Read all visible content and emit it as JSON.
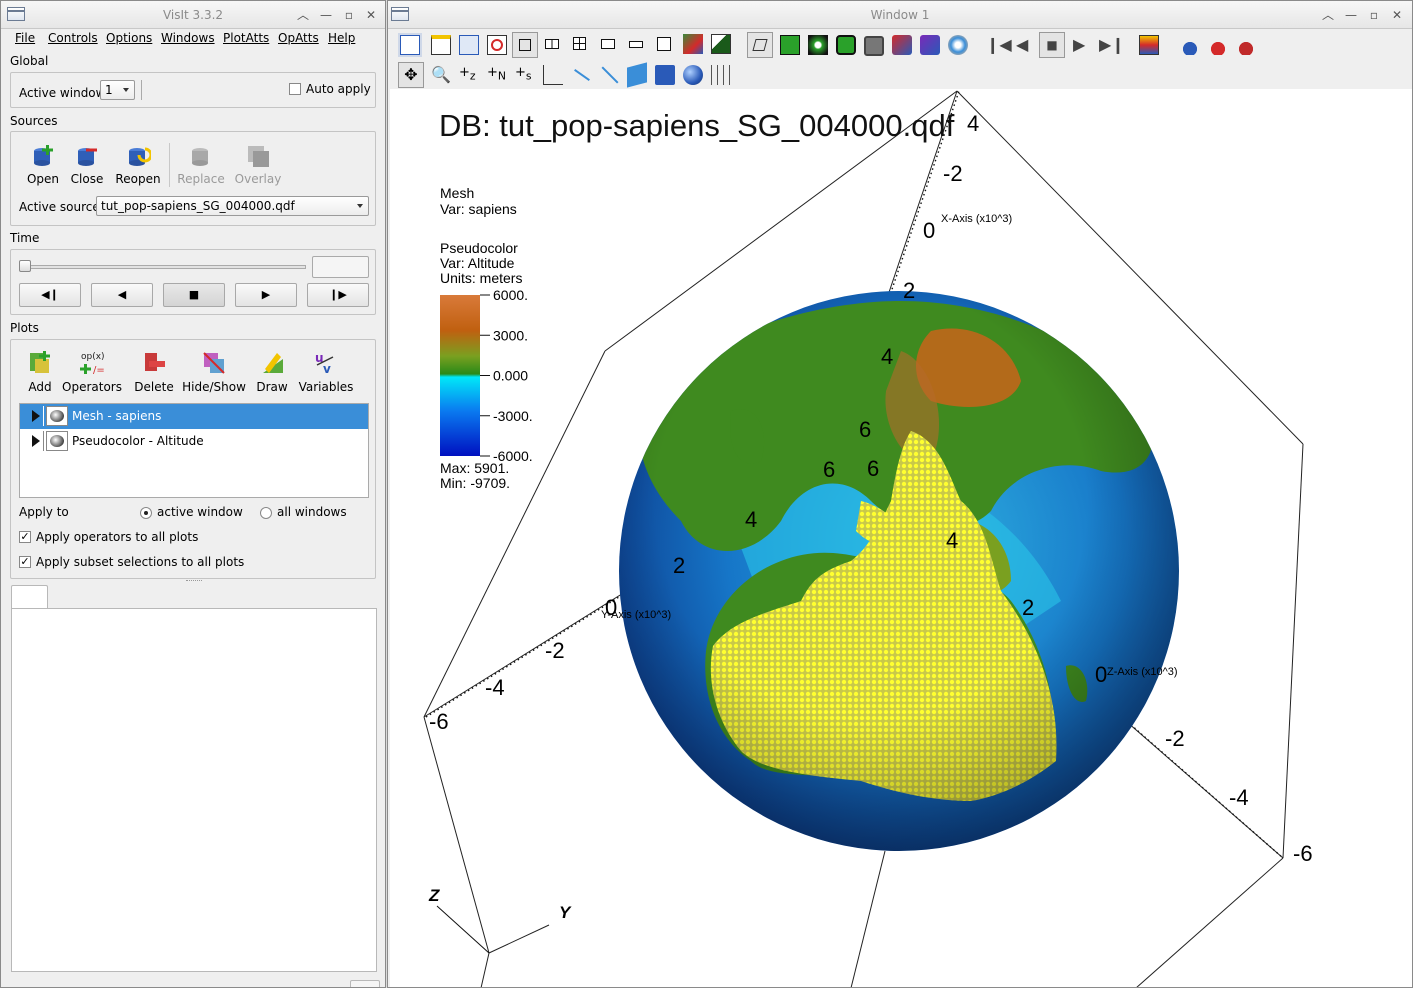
{
  "main_window": {
    "title": "VisIt 3.3.2",
    "menus": [
      "File",
      "Controls",
      "Options",
      "Windows",
      "PlotAtts",
      "OpAtts",
      "Help"
    ],
    "global": {
      "section_label": "Global",
      "active_window_label": "Active window",
      "active_window_value": "1",
      "auto_apply_label": "Auto apply",
      "auto_apply_checked": false
    },
    "sources": {
      "section_label": "Sources",
      "buttons": [
        "Open",
        "Close",
        "Reopen",
        "Replace",
        "Overlay"
      ],
      "active_source_label": "Active source",
      "active_source_value": "tut_pop-sapiens_SG_004000.qdf"
    },
    "time": {
      "section_label": "Time",
      "slider_fraction": 0.0,
      "time_field_value": ""
    },
    "plots": {
      "section_label": "Plots",
      "buttons": [
        "Add",
        "Operators",
        "Delete",
        "Hide/Show",
        "Draw",
        "Variables"
      ],
      "plot_list": [
        {
          "label": "Mesh - sapiens",
          "selected": true
        },
        {
          "label": "Pseudocolor - Altitude",
          "selected": false
        }
      ],
      "apply_to_label": "Apply to",
      "apply_options": [
        "active window",
        "all windows"
      ],
      "apply_selected": "active window",
      "apply_operators_label": "Apply operators to all plots",
      "apply_operators_checked": true,
      "apply_subsets_label": "Apply subset selections to all plots",
      "apply_subsets_checked": true
    }
  },
  "vis_window": {
    "title": "Window 1",
    "db_title": "DB: tut_pop-sapiens_SG_004000.qdf",
    "legend_mesh": {
      "title": "Mesh",
      "var": "Var: sapiens"
    },
    "legend_pc": {
      "title": "Pseudocolor",
      "var": "Var: Altitude",
      "units": "Units: meters",
      "ticks": [
        "6000.",
        "3000.",
        "0.000",
        "-3000.",
        "-6000."
      ],
      "max": "Max:  5901.",
      "min": "Min: -9709."
    },
    "axes": {
      "x_label": "X-Axis (x10^3)",
      "y_label": "Y-Axis (x10^3)",
      "z_label": "Z-Axis (x10^3)",
      "x_ticks": [
        "4",
        "-2",
        "0",
        "2",
        "4",
        "6"
      ],
      "y_ticks": [
        "6",
        "4",
        "2",
        "0",
        "-2",
        "-4",
        "-6"
      ],
      "z_ticks": [
        "6",
        "4",
        "2",
        "0",
        "-2",
        "-4",
        "-6"
      ],
      "triad": [
        "Z",
        "Y"
      ]
    },
    "colors": {
      "land_green": "#3f8a1f",
      "ocean_deep": "#0a3ea0",
      "ocean_shallow": "#29c4e8",
      "mesh_points": "#f0f020",
      "highland": "#c8641a"
    }
  }
}
